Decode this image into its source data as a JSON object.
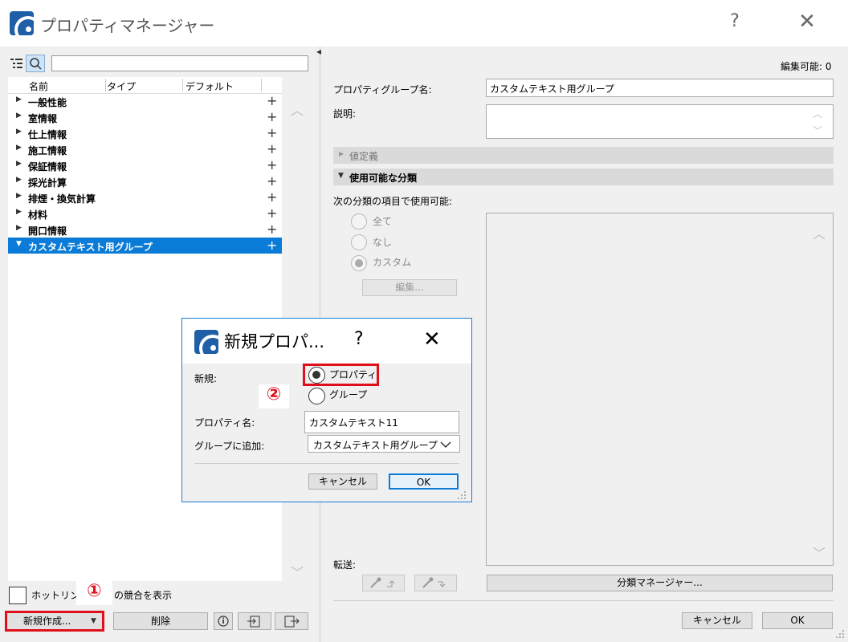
{
  "window": {
    "title": "プロパティマネージャー",
    "help_glyph": "?",
    "close_glyph": "✕"
  },
  "left": {
    "columns": [
      "名前",
      "タイプ",
      "デフォルト"
    ],
    "tree_items": [
      {
        "label": "一般性能",
        "arrow": "▶",
        "selected": false
      },
      {
        "label": "室情報",
        "arrow": "▶",
        "selected": false
      },
      {
        "label": "仕上情報",
        "arrow": "▶",
        "selected": false
      },
      {
        "label": "施工情報",
        "arrow": "▶",
        "selected": false
      },
      {
        "label": "保証情報",
        "arrow": "▶",
        "selected": false
      },
      {
        "label": "採光計算",
        "arrow": "▶",
        "selected": false
      },
      {
        "label": "排煙・換気計算",
        "arrow": "▶",
        "selected": false
      },
      {
        "label": "材料",
        "arrow": "▶",
        "selected": false
      },
      {
        "label": "開口情報",
        "arrow": "▶",
        "selected": false
      },
      {
        "label": "カスタムテキスト用グループ",
        "arrow": "▼",
        "selected": true
      }
    ],
    "plus_glyph": "+",
    "checkbox_label_a": "ホットリンク",
    "checkbox_label_b": "ィの競合を表示",
    "new_button": "新規作成...",
    "delete_button": "削除",
    "marker_1": "①"
  },
  "right": {
    "edit_status": "編集可能: 0",
    "group_name_label": "プロパティグループ名:",
    "group_name_value": "カスタムテキスト用グループ",
    "description_label": "説明:",
    "section_value_def": "値定義",
    "section_classification": "使用可能な分類",
    "available_label": "次の分類の項目で使用可能:",
    "radio_all": "全て",
    "radio_none": "なし",
    "radio_custom": "カスタム",
    "edit_button": "編集...",
    "transfer_label": "転送:",
    "class_manager_button": "分類マネージャー...",
    "cancel_button": "キャンセル",
    "ok_button": "OK"
  },
  "dialog": {
    "title": "新規プロパ...",
    "help_glyph": "?",
    "close_glyph": "✕",
    "new_label": "新規:",
    "option_property": "プロパティ",
    "option_group": "グループ",
    "property_name_label": "プロパティ名:",
    "property_name_value": "カスタムテキスト11",
    "add_to_group_label": "グループに追加:",
    "add_to_group_value": "カスタムテキスト用グループ",
    "cancel_button": "キャンセル",
    "ok_button": "OK",
    "marker_2": "②"
  },
  "colors": {
    "accent": "#0a7bd6",
    "highlight": "#e0101a"
  }
}
